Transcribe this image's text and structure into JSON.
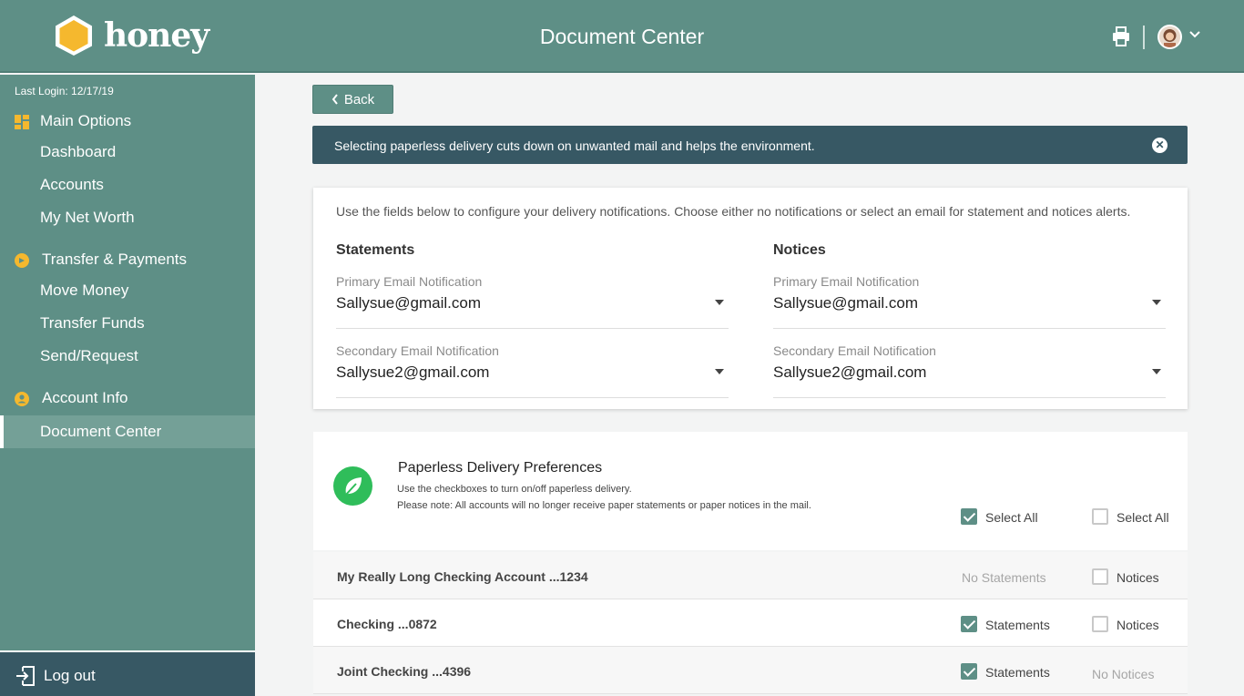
{
  "brand": {
    "name": "honey",
    "accent": "#5e8f86",
    "logo_color": "#f5b82e"
  },
  "header": {
    "title": "Document Center",
    "print_icon": "printer-icon",
    "profile_icon": "avatar"
  },
  "sidebar": {
    "last_login": "Last Login: 12/17/19",
    "sections": [
      {
        "label": "Main Options",
        "icon": "grid-icon",
        "items": [
          "Dashboard",
          "Accounts",
          "My Net Worth"
        ]
      },
      {
        "label": "Transfer & Payments",
        "icon": "arrow-circle-icon",
        "items": [
          "Move Money",
          "Transfer Funds",
          "Send/Request"
        ]
      },
      {
        "label": "Account Info",
        "icon": "user-circle-icon",
        "items": [
          "Document Center"
        ]
      }
    ],
    "active_item": "Document Center",
    "logout": "Log out"
  },
  "main": {
    "back_label": "Back",
    "banner": "Selecting paperless delivery cuts down on unwanted mail and helps the environment.",
    "config": {
      "intro": "Use the fields below to configure your delivery notifications. Choose either no notifications or select an email for statement and notices alerts.",
      "statements": {
        "title": "Statements",
        "primary_label": "Primary Email Notification",
        "primary_value": "Sallysue@gmail.com",
        "secondary_label": "Secondary Email Notification",
        "secondary_value": "Sallysue2@gmail.com"
      },
      "notices": {
        "title": "Notices",
        "primary_label": "Primary Email Notification",
        "primary_value": "Sallysue@gmail.com",
        "secondary_label": "Secondary Email Notification",
        "secondary_value": "Sallysue2@gmail.com"
      }
    },
    "preferences": {
      "title": "Paperless Delivery Preferences",
      "desc1": "Use the checkboxes to turn on/off paperless delivery.",
      "desc2": "Please note: All accounts will no longer receive paper statements or paper notices in the mail.",
      "select_all_statements": {
        "label": "Select All",
        "checked": true
      },
      "select_all_notices": {
        "label": "Select All",
        "checked": false
      }
    },
    "accounts": [
      {
        "name": "My Really Long Checking Account ...1234",
        "statements": "No Statements",
        "notices": "Notices",
        "notices_checked": false
      },
      {
        "name": "Checking ...0872",
        "statements": "Statements",
        "statements_checked": true,
        "notices": "Notices",
        "notices_checked": false
      },
      {
        "name": "Joint Checking ...4396",
        "statements": "Statements",
        "statements_checked": true,
        "notices": "No Notices"
      }
    ]
  }
}
